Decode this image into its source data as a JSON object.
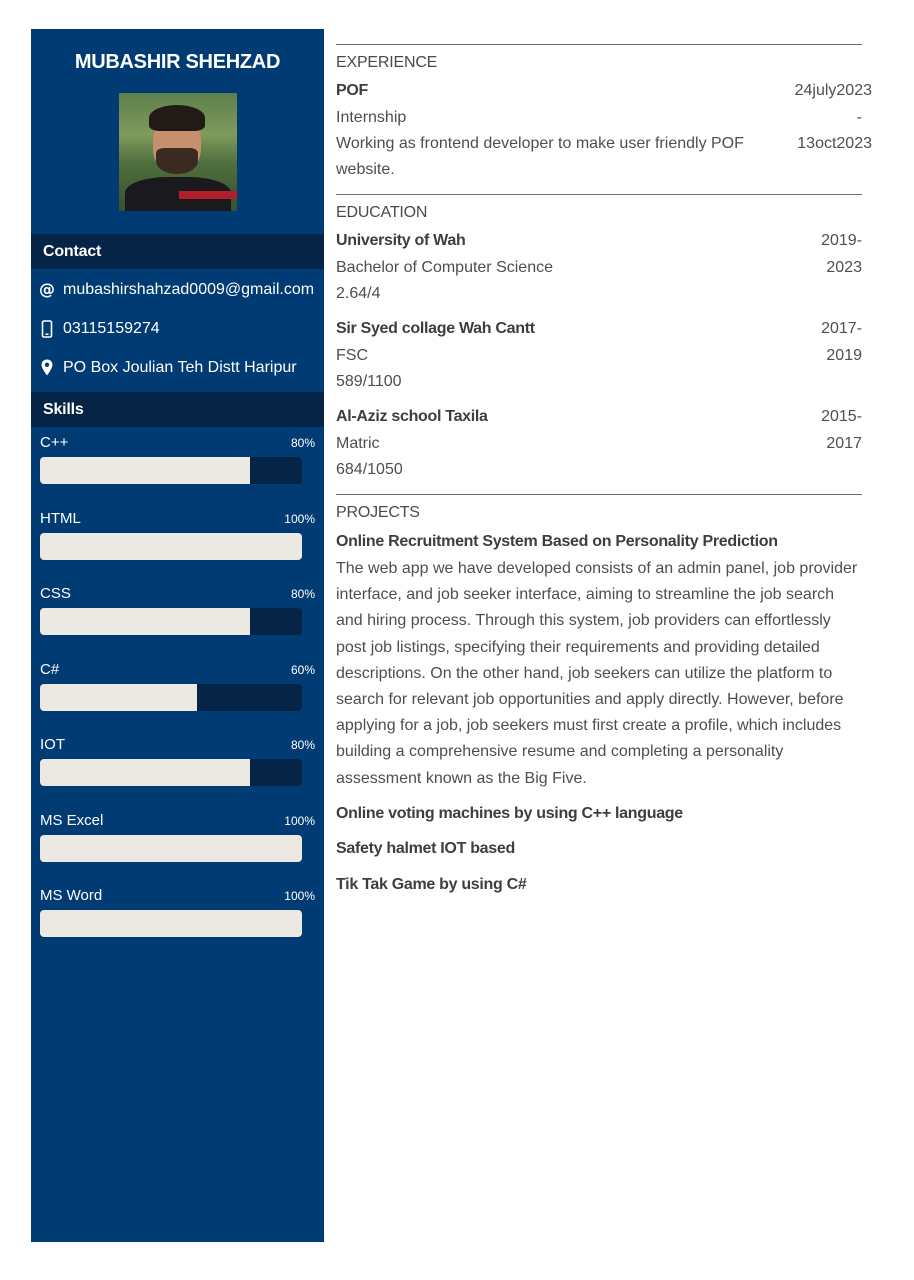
{
  "sidebar": {
    "name": "MUBASHIR SHEHZAD",
    "contact_heading": "Contact",
    "contact": {
      "email": "mubashirshahzad0009@gmail.com",
      "phone": "03115159274",
      "address": "PO Box Joulian Teh Distt Haripur"
    },
    "skills_heading": "Skills",
    "skills": [
      {
        "name": "C++",
        "percent_label": "80%",
        "level": 80
      },
      {
        "name": "HTML",
        "percent_label": "100%",
        "level": 100
      },
      {
        "name": "CSS",
        "percent_label": "80%",
        "level": 80
      },
      {
        "name": "C#",
        "percent_label": "60%",
        "level": 60
      },
      {
        "name": "IOT",
        "percent_label": "80%",
        "level": 80
      },
      {
        "name": "MS Excel",
        "percent_label": "100%",
        "level": 100
      },
      {
        "name": "MS Word",
        "percent_label": "100%",
        "level": 100
      }
    ]
  },
  "experience": {
    "heading": "EXPERIENCE",
    "company": "POF",
    "role": "Internship",
    "description": "Working as frontend developer to make user friendly POF website.",
    "date_start": "24july2023",
    "date_sep": "-",
    "date_end": "13oct2023"
  },
  "education": {
    "heading": "EDUCATION",
    "items": [
      {
        "school": "University of Wah",
        "degree": "Bachelor of Computer Science",
        "score": "2.64/4",
        "year_start": "2019-",
        "year_end": "2023"
      },
      {
        "school": "Sir Syed collage Wah Cantt",
        "degree": "FSC",
        "score": "589/1100",
        "year_start": "2017-",
        "year_end": "2019"
      },
      {
        "school": "Al-Aziz school Taxila",
        "degree": "Matric",
        "score": "684/1050",
        "year_start": "2015-",
        "year_end": "2017"
      }
    ]
  },
  "projects": {
    "heading": "PROJECTS",
    "items": [
      {
        "title": "Online Recruitment System Based on Personality Prediction",
        "description": "The web app we have developed consists of an admin panel, job provider interface, and job seeker interface, aiming to streamline the job search and hiring process. Through this system, job providers can effortlessly post job listings, specifying their requirements and providing detailed descriptions. On the other hand, job seekers can utilize the platform to search for relevant job opportunities and apply directly. However, before applying for a job, job seekers must first create a profile, which includes building a comprehensive resume and completing a personality assessment known as the Big Five."
      },
      {
        "title": "Online voting machines by using C++ language"
      },
      {
        "title": "Safety halmet IOT based"
      },
      {
        "title": "Tik Tak Game by using C#"
      }
    ]
  },
  "icons": {
    "email": "at-icon",
    "phone": "mobile-phone-icon",
    "address": "map-pin-icon"
  },
  "colors": {
    "sidebar": "#003c73",
    "section_head": "#062445",
    "bar_fill": "#ece9e3"
  }
}
